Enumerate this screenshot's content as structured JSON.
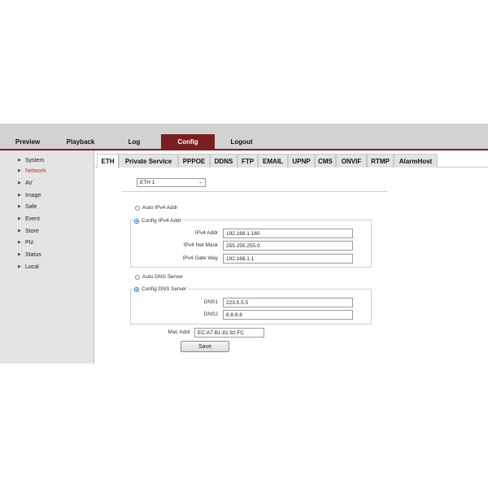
{
  "topnav": {
    "items": [
      {
        "label": "Preview"
      },
      {
        "label": "Playback"
      },
      {
        "label": "Log"
      },
      {
        "label": "Config"
      },
      {
        "label": "Logout"
      }
    ],
    "active_color": "#7a1f1f"
  },
  "sidebar": {
    "items": [
      {
        "label": "System"
      },
      {
        "label": "Network"
      },
      {
        "label": "AV"
      },
      {
        "label": "Image"
      },
      {
        "label": "Safe"
      },
      {
        "label": "Event"
      },
      {
        "label": "Store"
      },
      {
        "label": "Ptz"
      },
      {
        "label": "Status"
      },
      {
        "label": "Local"
      }
    ],
    "active_label_color": "#c0392b"
  },
  "tabs": [
    {
      "label": "ETH"
    },
    {
      "label": "Private Service"
    },
    {
      "label": "PPPOE"
    },
    {
      "label": "DDNS"
    },
    {
      "label": "FTP"
    },
    {
      "label": "EMAIL"
    },
    {
      "label": "UPNP"
    },
    {
      "label": "CMS"
    },
    {
      "label": "ONVIF"
    },
    {
      "label": "RTMP"
    },
    {
      "label": "AlarmHost"
    }
  ],
  "form": {
    "interface_select": "ETH 1",
    "ipv4": {
      "auto_label": "Auto IPv4 Addr",
      "config_label": "Config IPv4 Addr",
      "addr_label": "IPv4 Addr",
      "addr_value": "192.168.1.160",
      "mask_label": "IPv4 Net Mask",
      "mask_value": "255.255.255.0",
      "gateway_label": "IPv4 Gate Way",
      "gateway_value": "192.168.1.1"
    },
    "dns": {
      "auto_label": "Auto DNS Server",
      "config_label": "Config DNS Server",
      "dns1_label": "DNS1",
      "dns1_value": "223.5.5.5",
      "dns2_label": "DNS2",
      "dns2_value": "8.8.8.8"
    },
    "mac_label": "Mac Addr",
    "mac_value": "EC:A7:B1:81:92:FC",
    "save_label": "Save"
  }
}
